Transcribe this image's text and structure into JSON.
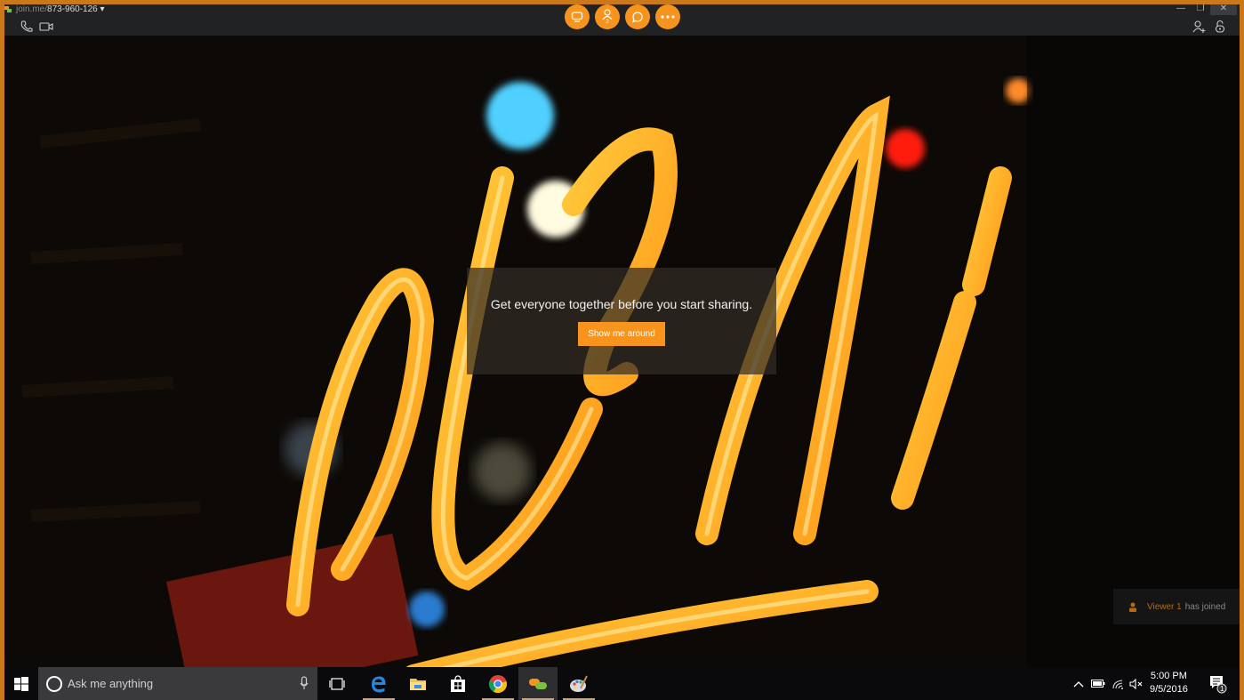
{
  "window": {
    "title_prefix": "join.me/",
    "meeting_id": "873-960-126",
    "title_dropdown": "▾",
    "controls": {
      "minimize": "—",
      "restore": "❐",
      "close": "✕"
    }
  },
  "toolbar": {
    "left_icons": [
      "phone-icon",
      "video-camera-icon"
    ],
    "center_buttons": [
      "screen-share-icon",
      "participants-icon",
      "chat-icon",
      "more-icon"
    ],
    "participants_count": "2",
    "right_icons": [
      "add-person-icon",
      "lock-icon"
    ],
    "accent": "#f7941d"
  },
  "overlay": {
    "message": "Get everyone together before you start sharing.",
    "button_label": "Show me around"
  },
  "toast": {
    "viewer_name": "Viewer 1",
    "suffix": "has joined"
  },
  "taskbar": {
    "search_placeholder": "Ask me anything",
    "apps": [
      "task-view",
      "edge",
      "file-explorer",
      "store",
      "chrome",
      "join-me",
      "paint"
    ],
    "time": "5:00 PM",
    "date": "9/5/2016",
    "notification_count": "1"
  }
}
